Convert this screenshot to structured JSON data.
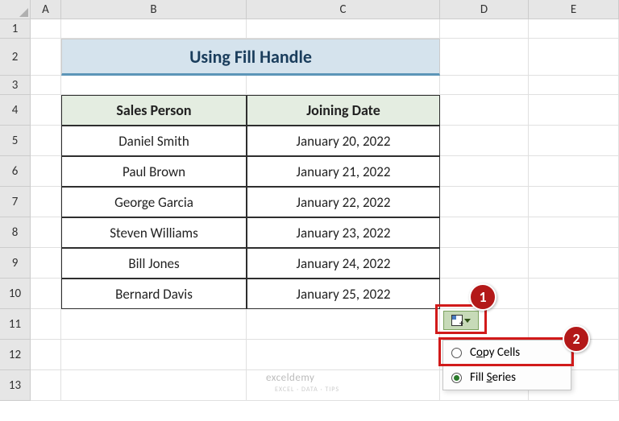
{
  "columns": [
    "A",
    "B",
    "C",
    "D",
    "E"
  ],
  "rows": [
    "1",
    "2",
    "3",
    "4",
    "5",
    "6",
    "7",
    "8",
    "9",
    "10",
    "11",
    "12",
    "13"
  ],
  "title": "Using Fill Handle",
  "headers": {
    "col1": "Sales Person",
    "col2": "Joining Date"
  },
  "data": [
    {
      "person": "Daniel Smith",
      "date": "January 20, 2022"
    },
    {
      "person": "Paul Brown",
      "date": "January 21, 2022"
    },
    {
      "person": "George Garcia",
      "date": "January 22, 2022"
    },
    {
      "person": "Steven Williams",
      "date": "January 23, 2022"
    },
    {
      "person": "Bill Jones",
      "date": "January 24, 2022"
    },
    {
      "person": "Bernard Davis",
      "date": "January 25, 2022"
    }
  ],
  "menu": {
    "copy_cells_pre": "C",
    "copy_cells_mid": "o",
    "copy_cells_post": "py Cells",
    "fill_series_pre": "Fill ",
    "fill_series_mid": "S",
    "fill_series_post": "eries"
  },
  "badges": {
    "b1": "1",
    "b2": "2"
  },
  "watermark": "exceldemy",
  "watermark_sub": "EXCEL · DATA · TIPS"
}
